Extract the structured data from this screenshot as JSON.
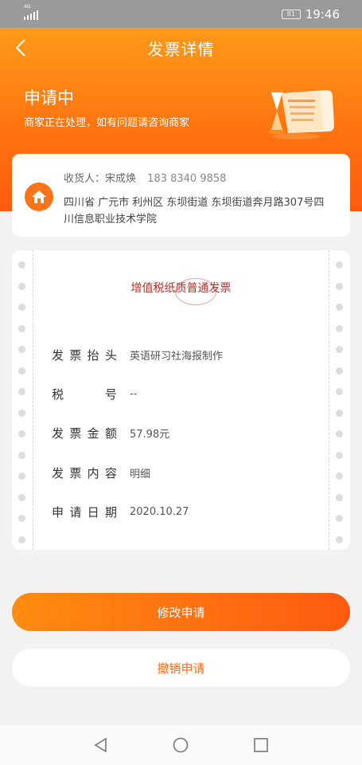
{
  "status_bar": {
    "network": "4G",
    "battery": "81",
    "time": "19:46"
  },
  "nav": {
    "title": "发票详情"
  },
  "status": {
    "title": "申请中",
    "subtitle": "商家正在处理，如有问题请咨询商家"
  },
  "address": {
    "receiver_label": "收货人：",
    "receiver_name": "宋成焕",
    "phone": "183 8340 9858",
    "address": "四川省 广元市 利州区 东坝街道 东坝街道奔月路307号四川信息职业技术学院"
  },
  "invoice": {
    "type": "增值税纸质普通发票",
    "fields": [
      {
        "label": "发票抬头",
        "value": "英语研习社海报制作"
      },
      {
        "label": "税号",
        "value": "--"
      },
      {
        "label": "发票金额",
        "value": "57.98元"
      },
      {
        "label": "发票内容",
        "value": "明细"
      },
      {
        "label": "申请日期",
        "value": "2020.10.27"
      }
    ]
  },
  "buttons": {
    "modify": "修改申请",
    "cancel": "撤销申请"
  },
  "colors": {
    "accent": "#ff7418",
    "invoice_type": "#b03028"
  },
  "icons": [
    "back-arrow-icon",
    "document-hourglass-icon",
    "home-icon",
    "triangle-back-icon",
    "circle-home-icon",
    "square-recent-icon"
  ]
}
